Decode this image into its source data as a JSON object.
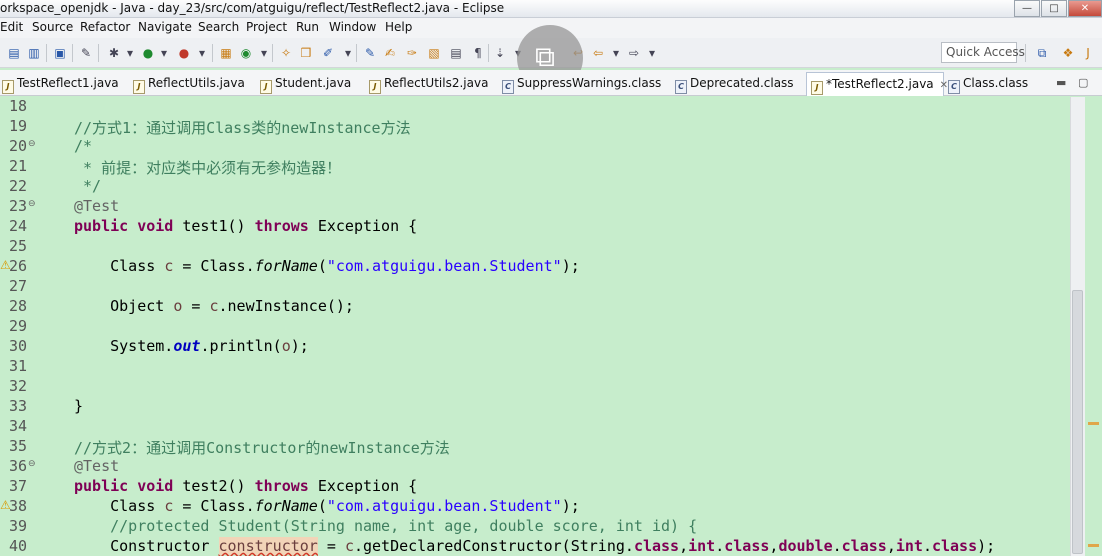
{
  "window": {
    "title": "orkspace_openjdk - Java - day_23/src/com/atguigu/reflect/TestReflect2.java - Eclipse",
    "min": "—",
    "max": "□",
    "close": "✕"
  },
  "menubar": [
    "Edit",
    "Source",
    "Refactor",
    "Navigate",
    "Search",
    "Project",
    "Run",
    "Window",
    "Help"
  ],
  "toolbar": {
    "quick_access": "Quick Access"
  },
  "tabs": [
    {
      "label": "TestReflect1.java",
      "icon": "J"
    },
    {
      "label": "ReflectUtils.java",
      "icon": "J"
    },
    {
      "label": "Student.java",
      "icon": "J"
    },
    {
      "label": "ReflectUtils2.java",
      "icon": "J"
    },
    {
      "label": "SuppressWarnings.class",
      "icon": "C"
    },
    {
      "label": "Deprecated.class",
      "icon": "C"
    },
    {
      "label": "*TestReflect2.java",
      "icon": "J",
      "active": true
    },
    {
      "label": "Class.class",
      "icon": "C"
    }
  ],
  "editor": {
    "lines": [
      {
        "n": "18"
      },
      {
        "n": "19",
        "t": "//方式1：通过调用Class类的newInstance方法"
      },
      {
        "n": "20",
        "t": "/*"
      },
      {
        "n": "21",
        "t": " * 前提：对应类中必须有无参构造器！"
      },
      {
        "n": "22",
        "t": " */"
      },
      {
        "n": "23",
        "t": "@Test"
      },
      {
        "n": "24",
        "k1": "public void",
        "t1": " test1() ",
        "k2": "throws",
        "t2": " Exception {"
      },
      {
        "n": "25"
      },
      {
        "n": "26",
        "a": "    Class ",
        "v": "c",
        "b": " = Class.",
        "s": "forName",
        "c": "(",
        "str": "\"com.atguigu.bean.Student\"",
        "d": ");"
      },
      {
        "n": "27"
      },
      {
        "n": "28",
        "a": "    Object ",
        "v": "o",
        "b": " = ",
        "v2": "c",
        "c": ".newInstance();"
      },
      {
        "n": "29"
      },
      {
        "n": "30",
        "a": "    System.",
        "f": "out",
        "b": ".println(",
        "v": "o",
        "c": ");"
      },
      {
        "n": "31"
      },
      {
        "n": "32"
      },
      {
        "n": "33",
        "t": "}"
      },
      {
        "n": "34"
      },
      {
        "n": "35",
        "t": "//方式2：通过调用Constructor的newInstance方法"
      },
      {
        "n": "36",
        "t": "@Test"
      },
      {
        "n": "37",
        "k1": "public void",
        "t1": " test2() ",
        "k2": "throws",
        "t2": " Exception {"
      },
      {
        "n": "38",
        "a": "    Class ",
        "v": "c",
        "b": " = Class.",
        "s": "forName",
        "c": "(",
        "str": "\"com.atguigu.bean.Student\"",
        "d": ");"
      },
      {
        "n": "39",
        "t": "    //protected Student(String name, int age, double score, int id) {"
      },
      {
        "n": "40",
        "a": "    Constructor ",
        "v": "constructor",
        "b": " = ",
        "v2": "c",
        "c": ".getDeclaredConstructor(String.",
        "k": "class",
        "d": ",",
        "k2": "int",
        "e": ".",
        "k3": "class",
        "f2": ",",
        "k4": "double",
        "g": ".",
        "k5": "class",
        "h": ",",
        "k6": "int",
        "i": ".",
        "k7": "class",
        "j": ");"
      }
    ]
  },
  "overlay": {
    "icon": "popout-icon",
    "glyph": "⧉"
  }
}
